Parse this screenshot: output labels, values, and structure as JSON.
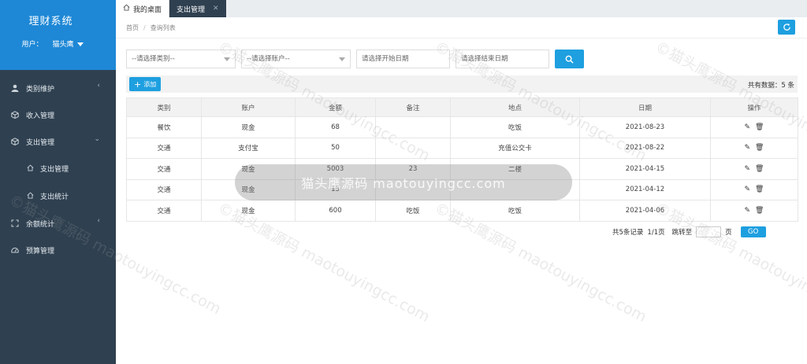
{
  "sidebar": {
    "title": "理财系统",
    "user_label": "用户：",
    "user_name": "猫头鹰",
    "items": [
      {
        "label": "类别维护",
        "icon": "user-icon"
      },
      {
        "label": "收入管理",
        "icon": "cube-icon"
      },
      {
        "label": "支出管理",
        "icon": "cube-icon"
      },
      {
        "label": "支出管理",
        "icon": "home-icon",
        "sub": true
      },
      {
        "label": "支出统计",
        "icon": "home-icon",
        "sub": true
      },
      {
        "label": "余额统计",
        "icon": "expand-icon"
      },
      {
        "label": "预算管理",
        "icon": "gauge-icon"
      }
    ]
  },
  "tabs": [
    {
      "label": "我的桌面"
    },
    {
      "label": "支出管理"
    }
  ],
  "breadcrumb": {
    "home": "首页",
    "sep": "/",
    "current": "查询列表"
  },
  "filters": {
    "category_placeholder": "--请选择类别--",
    "account_placeholder": "--请选择账户--",
    "start_placeholder": "请选择开始日期",
    "end_placeholder": "请选择结束日期"
  },
  "toolbar": {
    "add_label": "添加",
    "total_text": "共有数据：5 条"
  },
  "table": {
    "headers": [
      "类别",
      "账户",
      "金额",
      "备注",
      "地点",
      "日期",
      "操作"
    ],
    "rows": [
      [
        "餐饮",
        "现金",
        "68",
        "",
        "吃饭",
        "2021-08-23"
      ],
      [
        "交通",
        "支付宝",
        "50",
        "",
        "充值公交卡",
        "2021-08-22"
      ],
      [
        "交通",
        "现金",
        "5003",
        "23",
        "二楼",
        "2021-04-15"
      ],
      [
        "交通",
        "现金",
        "15",
        "",
        "",
        "2021-04-12"
      ],
      [
        "交通",
        "现金",
        "600",
        "吃饭",
        "吃饭",
        "2021-04-06"
      ]
    ]
  },
  "pager": {
    "summary": "共5条记录",
    "pages": "1/1页",
    "jump_label": "跳转至",
    "page_unit": "页",
    "go_label": "GO"
  },
  "watermark": {
    "text": "©猫头鹰源码 maotouyingcc.com",
    "banner_text": "猫头鹰源码 maotouyingcc.com"
  },
  "colors": {
    "sidebar_bg": "#2f4050",
    "sidebar_head": "#1e88d6",
    "accent": "#1e9fe0"
  }
}
